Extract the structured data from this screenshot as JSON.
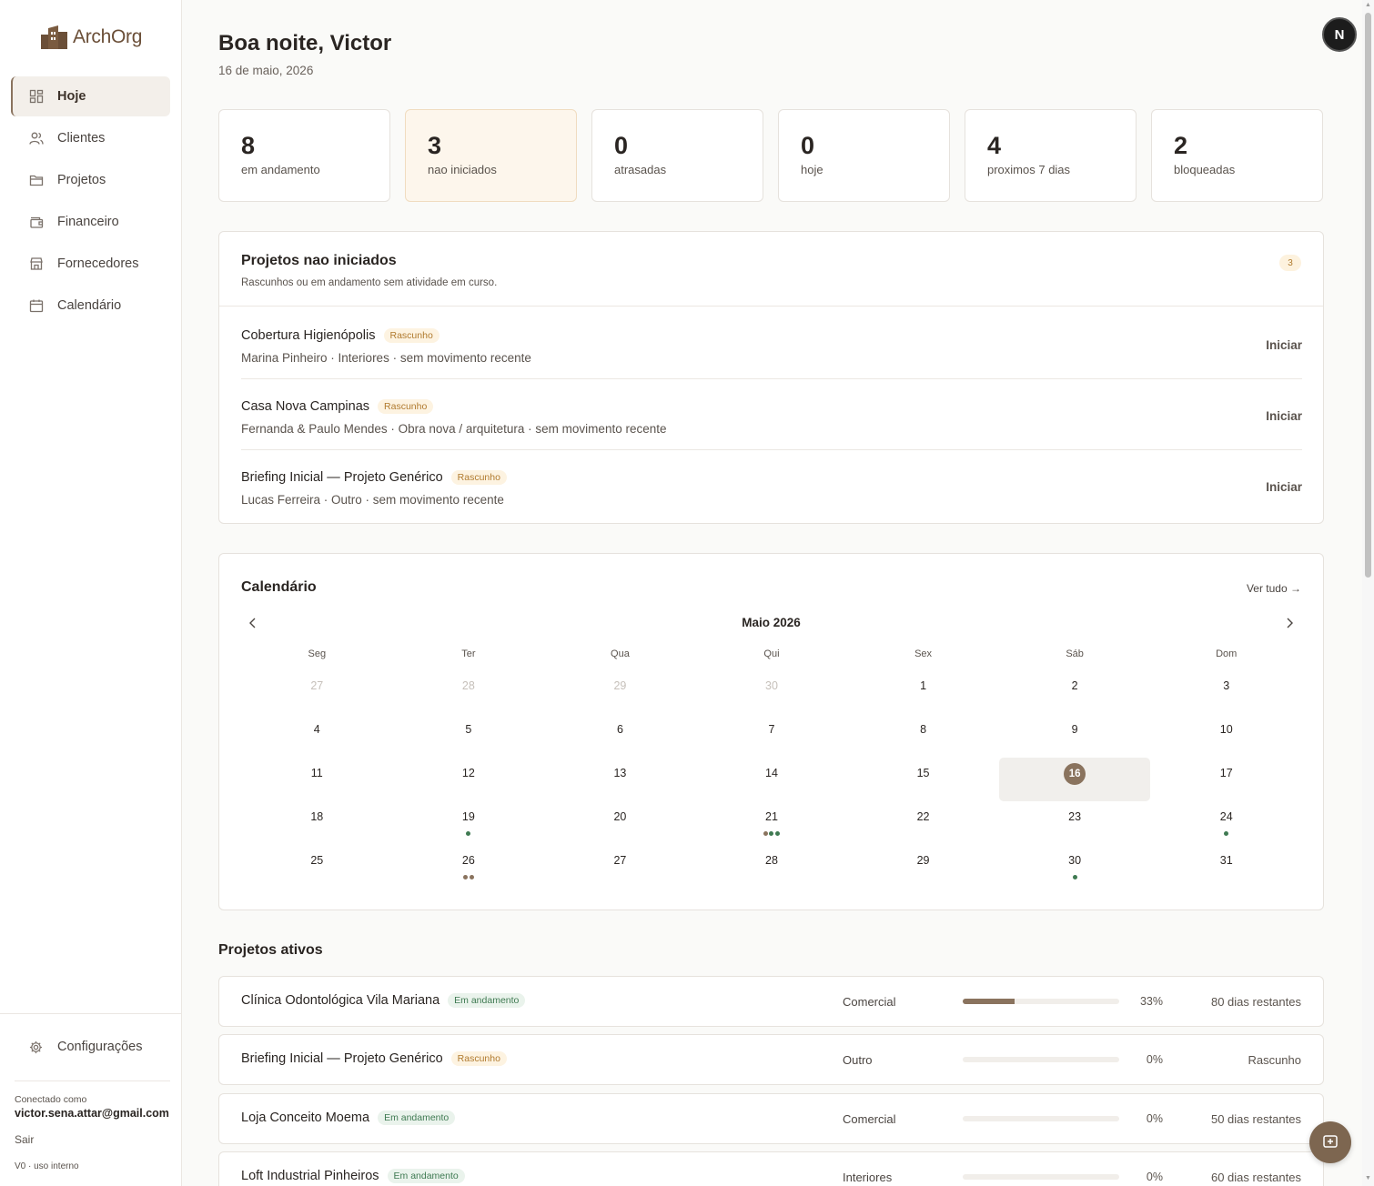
{
  "brand": {
    "name": "ArchOrg"
  },
  "sidebar": {
    "items": [
      {
        "label": "Hoje",
        "icon": "dashboard-icon",
        "active": true
      },
      {
        "label": "Clientes",
        "icon": "users-icon"
      },
      {
        "label": "Projetos",
        "icon": "folder-icon"
      },
      {
        "label": "Financeiro",
        "icon": "wallet-icon"
      },
      {
        "label": "Fornecedores",
        "icon": "store-icon"
      },
      {
        "label": "Calendário",
        "icon": "calendar-icon"
      }
    ],
    "settings_label": "Configurações",
    "connected_label": "Conectado como",
    "email": "victor.sena.attar@gmail.com",
    "logout_label": "Sair",
    "version": "V0 · uso interno"
  },
  "header": {
    "greeting": "Boa noite, Victor",
    "date": "16 de maio, 2026",
    "avatar_initial": "N"
  },
  "stats": [
    {
      "value": "8",
      "label": "em andamento"
    },
    {
      "value": "3",
      "label": "nao iniciados"
    },
    {
      "value": "0",
      "label": "atrasadas"
    },
    {
      "value": "0",
      "label": "hoje"
    },
    {
      "value": "4",
      "label": "proximos 7 dias"
    },
    {
      "value": "2",
      "label": "bloqueadas"
    }
  ],
  "not_started": {
    "title": "Projetos nao iniciados",
    "subtitle": "Rascunhos ou em andamento sem atividade em curso.",
    "count": "3",
    "action_label": "Iniciar",
    "projects": [
      {
        "name": "Cobertura Higienópolis",
        "badge": "Rascunho",
        "meta": "Marina Pinheiro · Interiores · sem movimento recente"
      },
      {
        "name": "Casa Nova Campinas",
        "badge": "Rascunho",
        "meta": "Fernanda & Paulo Mendes · Obra nova / arquitetura · sem movimento recente"
      },
      {
        "name": "Briefing Inicial — Projeto Genérico",
        "badge": "Rascunho",
        "meta": "Lucas Ferreira · Outro · sem movimento recente"
      }
    ]
  },
  "calendar": {
    "title": "Calendário",
    "see_all": "Ver tudo →",
    "month_label": "Maio 2026",
    "weekdays": [
      "Seg",
      "Ter",
      "Qua",
      "Qui",
      "Sex",
      "Sáb",
      "Dom"
    ],
    "today": "16",
    "dot_colors": {
      "green": "#3f7a52",
      "brown": "#8a735e"
    },
    "weeks": [
      [
        {
          "d": "27",
          "out": true
        },
        {
          "d": "28",
          "out": true
        },
        {
          "d": "29",
          "out": true
        },
        {
          "d": "30",
          "out": true
        },
        {
          "d": "1"
        },
        {
          "d": "2"
        },
        {
          "d": "3"
        }
      ],
      [
        {
          "d": "4"
        },
        {
          "d": "5"
        },
        {
          "d": "6"
        },
        {
          "d": "7"
        },
        {
          "d": "8"
        },
        {
          "d": "9"
        },
        {
          "d": "10"
        }
      ],
      [
        {
          "d": "11"
        },
        {
          "d": "12"
        },
        {
          "d": "13"
        },
        {
          "d": "14"
        },
        {
          "d": "15"
        },
        {
          "d": "16",
          "today": true
        },
        {
          "d": "17"
        }
      ],
      [
        {
          "d": "18"
        },
        {
          "d": "19",
          "dots": [
            "green"
          ]
        },
        {
          "d": "20"
        },
        {
          "d": "21",
          "dots": [
            "brown",
            "green",
            "green"
          ]
        },
        {
          "d": "22"
        },
        {
          "d": "23"
        },
        {
          "d": "24",
          "dots": [
            "green"
          ]
        }
      ],
      [
        {
          "d": "25"
        },
        {
          "d": "26",
          "dots": [
            "brown",
            "brown"
          ]
        },
        {
          "d": "27"
        },
        {
          "d": "28"
        },
        {
          "d": "29"
        },
        {
          "d": "30",
          "dots": [
            "green"
          ]
        },
        {
          "d": "31"
        }
      ]
    ]
  },
  "active_projects": {
    "title": "Projetos ativos",
    "rows": [
      {
        "name": "Clínica Odontológica Vila Mariana",
        "badge": "Em andamento",
        "badge_type": "progress",
        "type": "Comercial",
        "progress": 33,
        "progress_label": "33%",
        "remaining": "80 dias restantes"
      },
      {
        "name": "Briefing Inicial — Projeto Genérico",
        "badge": "Rascunho",
        "badge_type": "draft",
        "type": "Outro",
        "progress": 0,
        "progress_label": "0%",
        "remaining": "Rascunho"
      },
      {
        "name": "Loja Conceito Moema",
        "badge": "Em andamento",
        "badge_type": "progress",
        "type": "Comercial",
        "progress": 0,
        "progress_label": "0%",
        "remaining": "50 dias restantes"
      },
      {
        "name": "Loft Industrial Pinheiros",
        "badge": "Em andamento",
        "badge_type": "progress",
        "type": "Interiores",
        "progress": 0,
        "progress_label": "0%",
        "remaining": "60 dias restantes"
      }
    ]
  }
}
